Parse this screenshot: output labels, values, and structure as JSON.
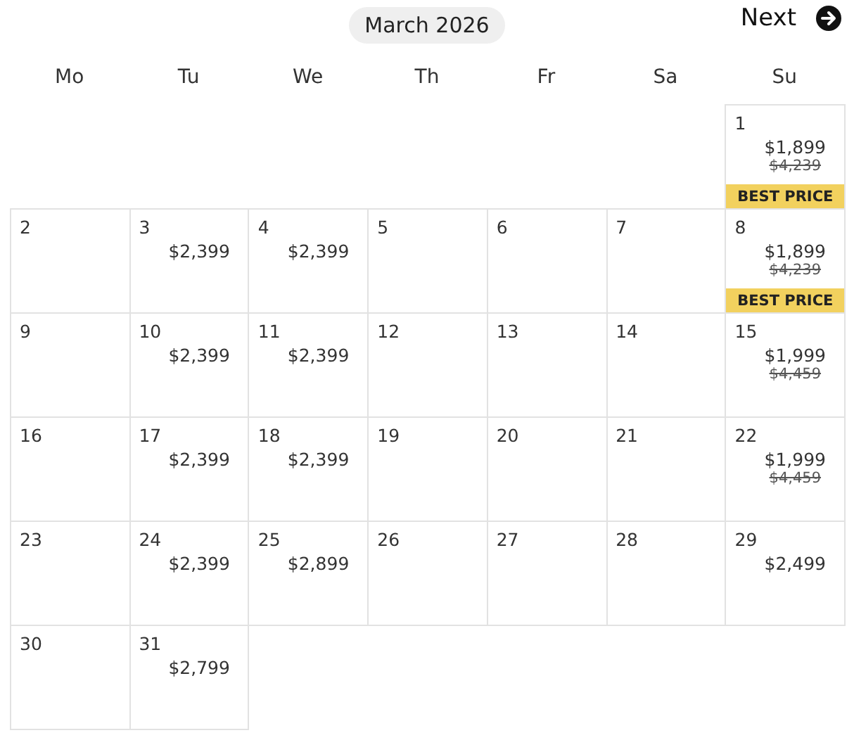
{
  "header": {
    "month": "March 2026",
    "next": "Next"
  },
  "weekdays": [
    "Mo",
    "Tu",
    "We",
    "Th",
    "Fr",
    "Sa",
    "Su"
  ],
  "weeks": [
    [
      {
        "kind": "empty"
      },
      {
        "kind": "empty"
      },
      {
        "kind": "empty"
      },
      {
        "kind": "empty"
      },
      {
        "kind": "empty"
      },
      {
        "kind": "empty"
      },
      {
        "kind": "day",
        "day": "1",
        "price": "$1,899",
        "old_price": "$4,239",
        "badge": "BEST PRICE"
      }
    ],
    [
      {
        "kind": "day",
        "day": "2"
      },
      {
        "kind": "day",
        "day": "3",
        "price": "$2,399"
      },
      {
        "kind": "day",
        "day": "4",
        "price": "$2,399"
      },
      {
        "kind": "day",
        "day": "5"
      },
      {
        "kind": "day",
        "day": "6"
      },
      {
        "kind": "day",
        "day": "7"
      },
      {
        "kind": "day",
        "day": "8",
        "price": "$1,899",
        "old_price": "$4,239",
        "badge": "BEST PRICE"
      }
    ],
    [
      {
        "kind": "day",
        "day": "9"
      },
      {
        "kind": "day",
        "day": "10",
        "price": "$2,399"
      },
      {
        "kind": "day",
        "day": "11",
        "price": "$2,399"
      },
      {
        "kind": "day",
        "day": "12"
      },
      {
        "kind": "day",
        "day": "13"
      },
      {
        "kind": "day",
        "day": "14"
      },
      {
        "kind": "day",
        "day": "15",
        "price": "$1,999",
        "old_price": "$4,459"
      }
    ],
    [
      {
        "kind": "day",
        "day": "16"
      },
      {
        "kind": "day",
        "day": "17",
        "price": "$2,399"
      },
      {
        "kind": "day",
        "day": "18",
        "price": "$2,399"
      },
      {
        "kind": "day",
        "day": "19"
      },
      {
        "kind": "day",
        "day": "20"
      },
      {
        "kind": "day",
        "day": "21"
      },
      {
        "kind": "day",
        "day": "22",
        "price": "$1,999",
        "old_price": "$4,459"
      }
    ],
    [
      {
        "kind": "day",
        "day": "23"
      },
      {
        "kind": "day",
        "day": "24",
        "price": "$2,399"
      },
      {
        "kind": "day",
        "day": "25",
        "price": "$2,899"
      },
      {
        "kind": "day",
        "day": "26"
      },
      {
        "kind": "day",
        "day": "27"
      },
      {
        "kind": "day",
        "day": "28"
      },
      {
        "kind": "day",
        "day": "29",
        "price": "$2,499"
      }
    ],
    [
      {
        "kind": "day",
        "day": "30"
      },
      {
        "kind": "day",
        "day": "31",
        "price": "$2,799"
      },
      {
        "kind": "empty"
      },
      {
        "kind": "empty"
      },
      {
        "kind": "empty"
      },
      {
        "kind": "empty"
      },
      {
        "kind": "empty"
      }
    ]
  ]
}
